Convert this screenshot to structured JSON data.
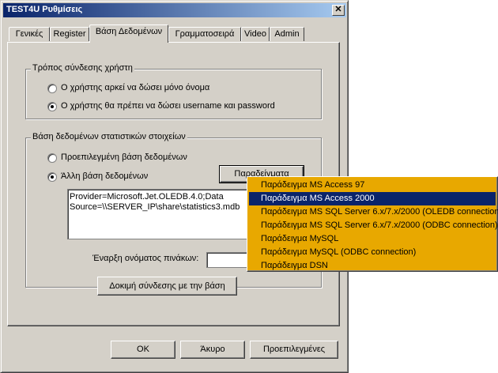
{
  "window": {
    "title": "TEST4U Ρυθμίσεις",
    "close_glyph": "✕"
  },
  "tabs": [
    {
      "label": "Γενικές"
    },
    {
      "label": "Register"
    },
    {
      "label": "Βάση Δεδομένων"
    },
    {
      "label": "Γραμματοσειρά"
    },
    {
      "label": "Video"
    },
    {
      "label": "Admin"
    }
  ],
  "active_tab": "Βάση Δεδομένων",
  "connection_group": {
    "title": "Τρόπος σύνδεσης χρήστη",
    "options": [
      {
        "label": "Ο χρήστης αρκεί να δώσει μόνο όνομα",
        "checked": false
      },
      {
        "label": "Ο χρήστης θα πρέπει να δώσει username και password",
        "checked": true
      }
    ]
  },
  "db_group": {
    "title": "Βάση δεδομένων στατιστικών στοιχείων",
    "options": [
      {
        "label": "Προεπιλεγμένη βάση δεδομένων",
        "checked": false
      },
      {
        "label": "Άλλη βάση δεδομένων",
        "checked": true
      }
    ],
    "examples_button": "Παραδείγματα",
    "connection_string": "Provider=Microsoft.Jet.OLEDB.4.0;Data\nSource=\\\\SERVER_IP\\share\\statistics3.mdb",
    "table_prefix_label": "Έναρξη ονόματος πινάκων:",
    "table_prefix_value": "",
    "test_button": "Δοκιμή σύνδεσης με την βάση"
  },
  "footer": {
    "ok": "OK",
    "cancel": "Άκυρο",
    "defaults": "Προεπιλεγμένες"
  },
  "examples_menu": {
    "selected_index": 1,
    "items": [
      "Παράδειγμα MS Access 97",
      "Παράδειγμα MS Access 2000",
      "Παράδειγμα MS SQL Server 6.x/7.x/2000 (OLEDB connection)",
      "Παράδειγμα MS SQL Server 6.x/7.x/2000 (ODBC connection)",
      "Παράδειγμα MySQL",
      "Παράδειγμα MySQL (ODBC connection)",
      "Παράδειγμα DSN"
    ]
  },
  "colors": {
    "face": "#d4d0c8",
    "title_start": "#0a246a",
    "title_end": "#a6caf0",
    "menu_bg": "#e8a800",
    "selection": "#0a246a"
  }
}
